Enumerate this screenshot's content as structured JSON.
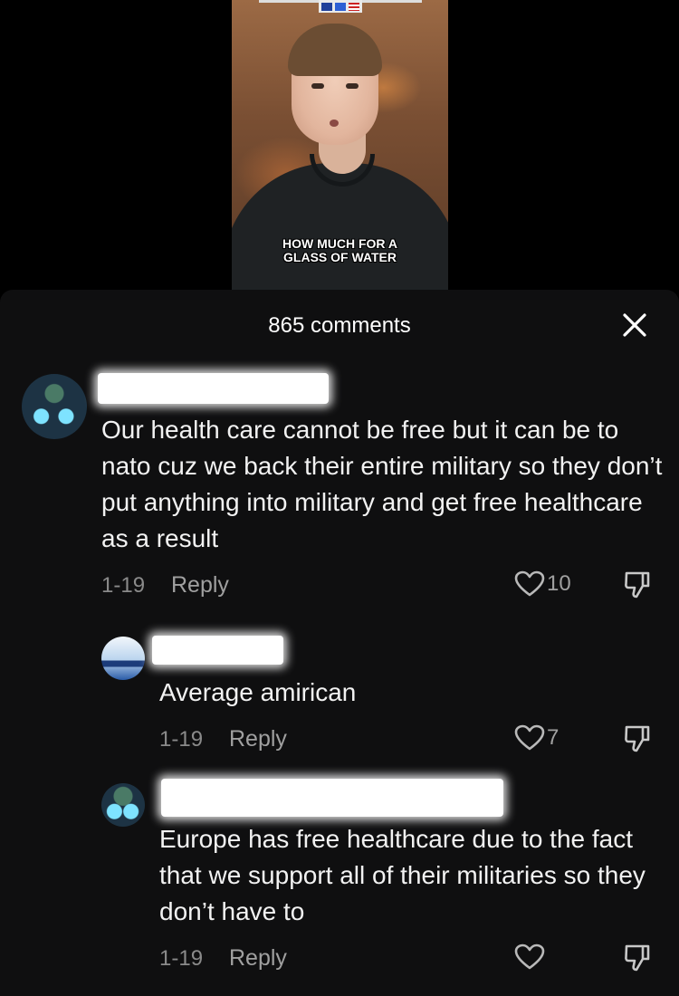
{
  "video": {
    "caption_line1": "HOW MUCH FOR A",
    "caption_line2": "GLASS OF WATER"
  },
  "comments_header": {
    "count_label": "865 comments",
    "close_icon": "close-icon"
  },
  "comments": [
    {
      "text": "Our health care cannot be free but it can be to nato cuz we back their entire military so they don’t put anything into military and get free healthcare as a result",
      "date": "1-19",
      "reply_label": "Reply",
      "likes": "10"
    },
    {
      "text": "Average amirican",
      "date": "1-19",
      "reply_label": "Reply",
      "likes": "7"
    },
    {
      "text": "Europe has free healthcare due to the fact that we support all of their militaries so they don’t have to",
      "date": "1-19",
      "reply_label": "Reply",
      "likes": ""
    }
  ],
  "colors": {
    "sheet_bg": "#0f0f10",
    "muted_text": "#a0a0a0"
  }
}
